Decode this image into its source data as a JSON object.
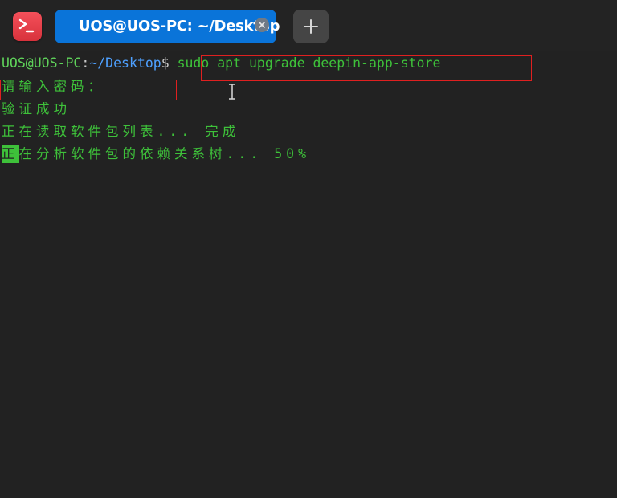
{
  "tab": {
    "title": "UOS@UOS-PC: ~/Desktop"
  },
  "icons": {
    "app": "terminal-icon",
    "close": "close-icon",
    "add": "plus-icon"
  },
  "terminal": {
    "prompt_user": "UOS@UOS-PC",
    "prompt_sep": ":",
    "prompt_path": "~/Desktop",
    "prompt_dollar": "$",
    "command": "sudo apt upgrade deepin-app-store",
    "lines": [
      "请输入密码：",
      "验证成功",
      "正在读取软件包列表... 完成",
      "在分析软件包的依赖关系树... 50%"
    ],
    "cursor_char": "正"
  },
  "colors": {
    "background": "#222222",
    "text_green": "#3ec13a",
    "path_blue": "#4ea0ff",
    "tab_blue": "#0a74d9",
    "highlight_red": "#e02020"
  }
}
